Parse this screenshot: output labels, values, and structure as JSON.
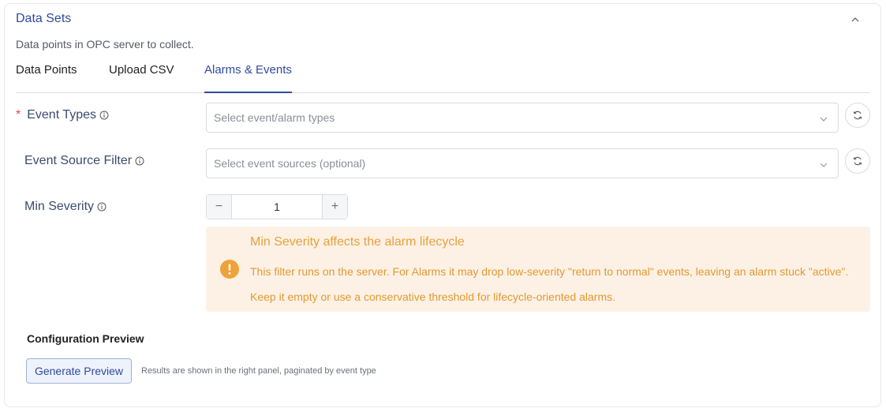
{
  "panel": {
    "title": "Data Sets",
    "description": "Data points in OPC server to collect."
  },
  "tabs": [
    {
      "label": "Data Points",
      "active": false
    },
    {
      "label": "Upload CSV",
      "active": false
    },
    {
      "label": "Alarms & Events",
      "active": true
    }
  ],
  "form": {
    "event_types": {
      "required_mark": "*",
      "label": "Event Types",
      "placeholder": "Select event/alarm types"
    },
    "event_source_filter": {
      "label": "Event Source Filter",
      "placeholder": "Select event sources (optional)"
    },
    "min_severity": {
      "label": "Min Severity",
      "value": "1",
      "minus": "−",
      "plus": "+"
    }
  },
  "alert": {
    "title": "Min Severity affects the alarm lifecycle",
    "body": "This filter runs on the server. For Alarms it may drop low-severity \"return to normal\" events, leaving an alarm stuck \"active\". Keep it empty or use a conservative threshold for lifecycle-oriented alarms."
  },
  "preview": {
    "title": "Configuration Preview",
    "button_label": "Generate Preview",
    "note": "Results are shown in the right panel, paginated by event type"
  },
  "colors": {
    "accent": "#2f4a9e",
    "warning": "#e8a13a",
    "required": "#e5484d"
  }
}
